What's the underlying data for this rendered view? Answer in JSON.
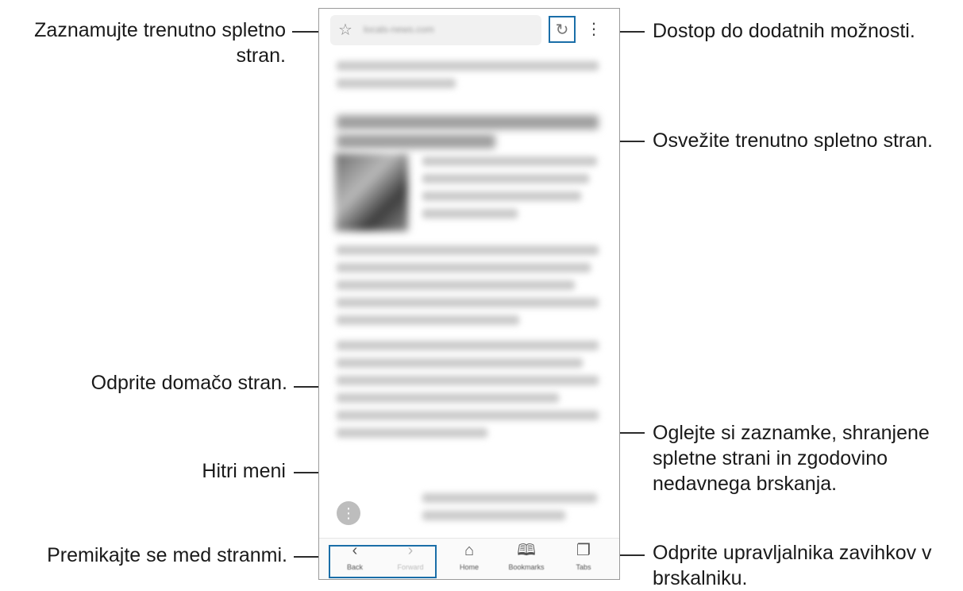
{
  "annotations": {
    "bookmark": "Zaznamujte trenutno spletno",
    "bookmark_2": "stran.",
    "more_options": "Dostop do dodatnih možnosti.",
    "refresh": "Osvežite trenutno spletno stran.",
    "home": "Odprite domačo stran.",
    "bookmarks_1": "Oglejte si zaznamke, shranjene",
    "bookmarks_2": "spletne strani in zgodovino",
    "bookmarks_3": "nedavnega brskanja.",
    "quick_menu": "Hitri meni",
    "navigate": "Premikajte se med stranmi.",
    "tabs_1": "Odprite upravljalnika zavihkov v",
    "tabs_2": "brskalniku."
  },
  "browser": {
    "url": "locals-news.com",
    "icons": {
      "star": "star-icon",
      "reload": "reload-icon",
      "more": "more-vertical-icon",
      "quick_menu": "quick-menu-icon"
    },
    "nav": [
      {
        "label": "Back",
        "icon": "chevron-left-icon",
        "glyph": "‹"
      },
      {
        "label": "Forward",
        "icon": "chevron-right-icon",
        "glyph": "›"
      },
      {
        "label": "Home",
        "icon": "home-icon",
        "glyph": "⌂"
      },
      {
        "label": "Bookmarks",
        "icon": "bookmarks-icon",
        "glyph": "🕮"
      },
      {
        "label": "Tabs",
        "icon": "tabs-icon",
        "glyph": "❐"
      }
    ]
  },
  "colors": {
    "highlight": "#1a6ea8",
    "callout_line": "#2b2b2b"
  }
}
